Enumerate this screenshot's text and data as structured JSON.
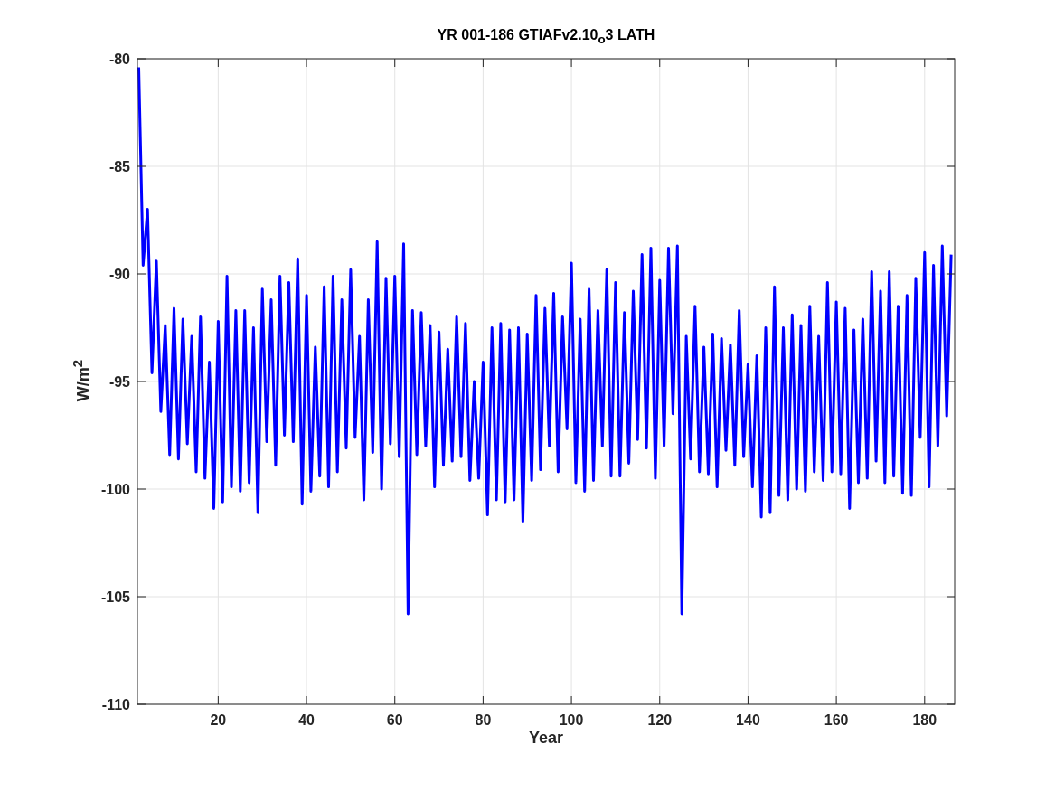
{
  "figure": {
    "chart_data": {
      "type": "line",
      "title": "YR 001-186 GTIAFv2.10$_{o}$3 LATH",
      "xlabel": "Year",
      "ylabel": "W/m$^{2}$",
      "xlim": [
        1.7,
        186.8
      ],
      "ylim": [
        -110,
        -80
      ],
      "xticks": [
        20,
        40,
        60,
        80,
        100,
        120,
        140,
        160,
        180
      ],
      "yticks": [
        -110,
        -105,
        -100,
        -95,
        -90,
        -85,
        -80
      ],
      "x": [
        2,
        3,
        4,
        5,
        6,
        7,
        8,
        9,
        10,
        11,
        12,
        13,
        14,
        15,
        16,
        17,
        18,
        19,
        20,
        21,
        22,
        23,
        24,
        25,
        26,
        27,
        28,
        29,
        30,
        31,
        32,
        33,
        34,
        35,
        36,
        37,
        38,
        39,
        40,
        41,
        42,
        43,
        44,
        45,
        46,
        47,
        48,
        49,
        50,
        51,
        52,
        53,
        54,
        55,
        56,
        57,
        58,
        59,
        60,
        61,
        62,
        63,
        64,
        65,
        66,
        67,
        68,
        69,
        70,
        71,
        72,
        73,
        74,
        75,
        76,
        77,
        78,
        79,
        80,
        81,
        82,
        83,
        84,
        85,
        86,
        87,
        88,
        89,
        90,
        91,
        92,
        93,
        94,
        95,
        96,
        97,
        98,
        99,
        100,
        101,
        102,
        103,
        104,
        105,
        106,
        107,
        108,
        109,
        110,
        111,
        112,
        113,
        114,
        115,
        116,
        117,
        118,
        119,
        120,
        121,
        122,
        123,
        124,
        125,
        126,
        127,
        128,
        129,
        130,
        131,
        132,
        133,
        134,
        135,
        136,
        137,
        138,
        139,
        140,
        141,
        142,
        143,
        144,
        145,
        146,
        147,
        148,
        149,
        150,
        151,
        152,
        153,
        154,
        155,
        156,
        157,
        158,
        159,
        160,
        161,
        162,
        163,
        164,
        165,
        166,
        167,
        168,
        169,
        170,
        171,
        172,
        173,
        174,
        175,
        176,
        177,
        178,
        179,
        180,
        181,
        182,
        183,
        184,
        185,
        186
      ],
      "grid": true,
      "series": [
        {
          "color": "#0000ff",
          "values": [
            -80.4,
            -89.6,
            -87.0,
            -94.6,
            -89.4,
            -96.4,
            -92.4,
            -98.4,
            -91.6,
            -98.6,
            -92.1,
            -97.9,
            -92.9,
            -99.2,
            -92.0,
            -99.5,
            -94.1,
            -100.9,
            -92.2,
            -100.6,
            -90.1,
            -99.9,
            -91.7,
            -100.1,
            -91.7,
            -99.7,
            -92.5,
            -101.1,
            -90.7,
            -97.8,
            -91.2,
            -98.9,
            -90.1,
            -97.5,
            -90.4,
            -97.8,
            -89.3,
            -100.7,
            -91.0,
            -100.1,
            -93.4,
            -99.4,
            -90.6,
            -99.9,
            -90.1,
            -99.2,
            -91.2,
            -98.1,
            -89.8,
            -97.6,
            -92.9,
            -100.5,
            -91.2,
            -98.3,
            -88.5,
            -100.0,
            -90.2,
            -97.9,
            -90.1,
            -98.5,
            -88.6,
            -105.8,
            -91.7,
            -98.4,
            -91.8,
            -98.0,
            -92.4,
            -99.9,
            -92.7,
            -98.9,
            -93.5,
            -98.7,
            -92.0,
            -98.5,
            -92.3,
            -99.6,
            -95.0,
            -99.5,
            -94.1,
            -101.2,
            -92.5,
            -100.5,
            -92.3,
            -100.6,
            -92.6,
            -100.5,
            -92.5,
            -101.5,
            -92.8,
            -99.6,
            -91.0,
            -99.1,
            -91.6,
            -98.0,
            -90.9,
            -99.2,
            -92.0,
            -97.2,
            -89.5,
            -99.7,
            -92.1,
            -100.1,
            -90.7,
            -99.6,
            -91.7,
            -98.0,
            -89.8,
            -99.4,
            -90.4,
            -99.4,
            -91.8,
            -98.8,
            -90.8,
            -97.7,
            -89.1,
            -98.1,
            -88.8,
            -99.5,
            -90.3,
            -98.0,
            -88.8,
            -96.5,
            -88.7,
            -105.8,
            -92.9,
            -98.6,
            -91.5,
            -99.2,
            -93.4,
            -99.3,
            -92.8,
            -99.9,
            -93.0,
            -98.2,
            -93.3,
            -98.9,
            -91.7,
            -98.5,
            -94.2,
            -99.9,
            -93.8,
            -101.3,
            -92.5,
            -101.1,
            -90.6,
            -100.3,
            -92.5,
            -100.5,
            -91.9,
            -100.0,
            -92.4,
            -100.1,
            -91.5,
            -99.2,
            -92.9,
            -99.6,
            -90.4,
            -99.2,
            -91.3,
            -99.3,
            -91.6,
            -100.9,
            -92.6,
            -99.7,
            -92.1,
            -99.5,
            -89.9,
            -98.7,
            -90.8,
            -99.7,
            -89.9,
            -99.4,
            -91.5,
            -100.2,
            -91.0,
            -100.3,
            -90.2,
            -97.6,
            -89.0,
            -99.9,
            -89.6,
            -98.0,
            -88.7,
            -96.6,
            -89.1
          ]
        }
      ]
    }
  }
}
